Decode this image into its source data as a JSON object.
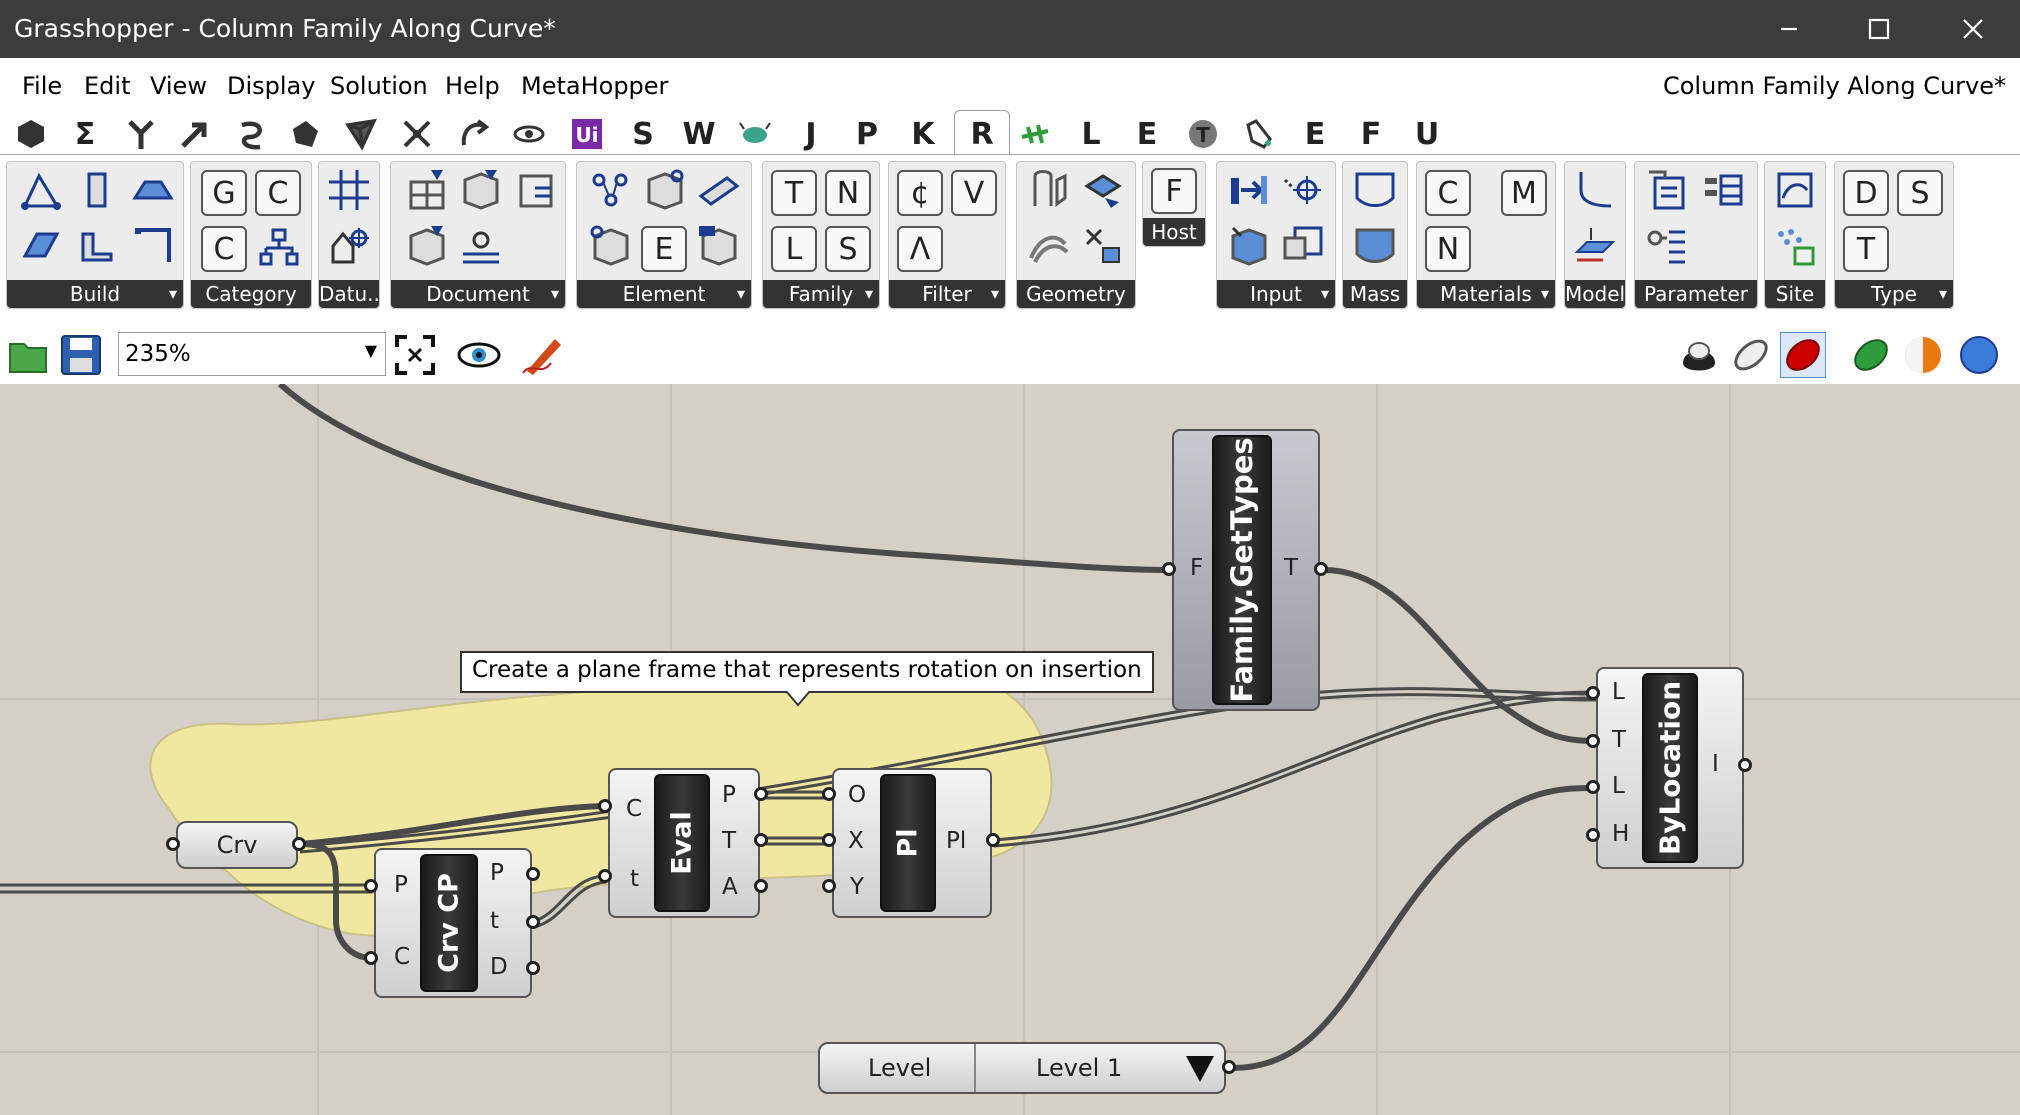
{
  "window": {
    "title": "Grasshopper - Column Family Along Curve*"
  },
  "menu": {
    "items": [
      "File",
      "Edit",
      "View",
      "Display",
      "Solution",
      "Help",
      "MetaHopper"
    ],
    "document_name": "Column Family Along Curve*"
  },
  "tabs": [
    "S",
    "W",
    "J",
    "P",
    "K",
    "R",
    "L",
    "E",
    "E",
    "F",
    "U"
  ],
  "active_tab": "R",
  "ribbon": {
    "panels": [
      "Build",
      "Category",
      "Datu...",
      "Document",
      "Element",
      "Family",
      "Filter",
      "Geometry",
      "Input",
      "Mass",
      "Materials",
      "Model",
      "Parameter",
      "Site",
      "Type"
    ],
    "host_label": "Host",
    "category_letters": [
      "G",
      "C",
      "C"
    ],
    "element_letter": "E",
    "family_letters": [
      "T",
      "N",
      "L",
      "S"
    ],
    "filter_letters": [
      "¢",
      "V",
      "Λ"
    ],
    "host_letter": "F",
    "materials_letters": [
      "C",
      "M",
      "N"
    ],
    "type_letters": [
      "D",
      "S",
      "T"
    ]
  },
  "toolbar": {
    "zoom": "235%"
  },
  "canvas": {
    "tooltip": "Create a plane frame that represents rotation on insertion",
    "crv": {
      "label": "Crv"
    },
    "crvcp": {
      "label": "Crv CP",
      "inputs": [
        "P",
        "C"
      ],
      "outputs": [
        "P",
        "t",
        "D"
      ]
    },
    "eval": {
      "label": "Eval",
      "inputs": [
        "C",
        "t"
      ],
      "outputs": [
        "P",
        "T",
        "A"
      ]
    },
    "pl": {
      "label": "Pl",
      "inputs": [
        "O",
        "X",
        "Y"
      ],
      "outputs": [
        "Pl"
      ]
    },
    "gettypes": {
      "label": "Family.GetTypes",
      "inputs": [
        "F"
      ],
      "outputs": [
        "T"
      ]
    },
    "bylocation": {
      "label": "ByLocation",
      "inputs": [
        "L",
        "T",
        "L",
        "H"
      ],
      "outputs": [
        "I"
      ]
    },
    "level": {
      "label": "Level",
      "value": "Level 1"
    }
  },
  "colors": {
    "titlebar": "#3c3c3c",
    "canvas": "#d4d0c8",
    "group": "#f0e8a0",
    "wire": "#4a4a4a"
  }
}
